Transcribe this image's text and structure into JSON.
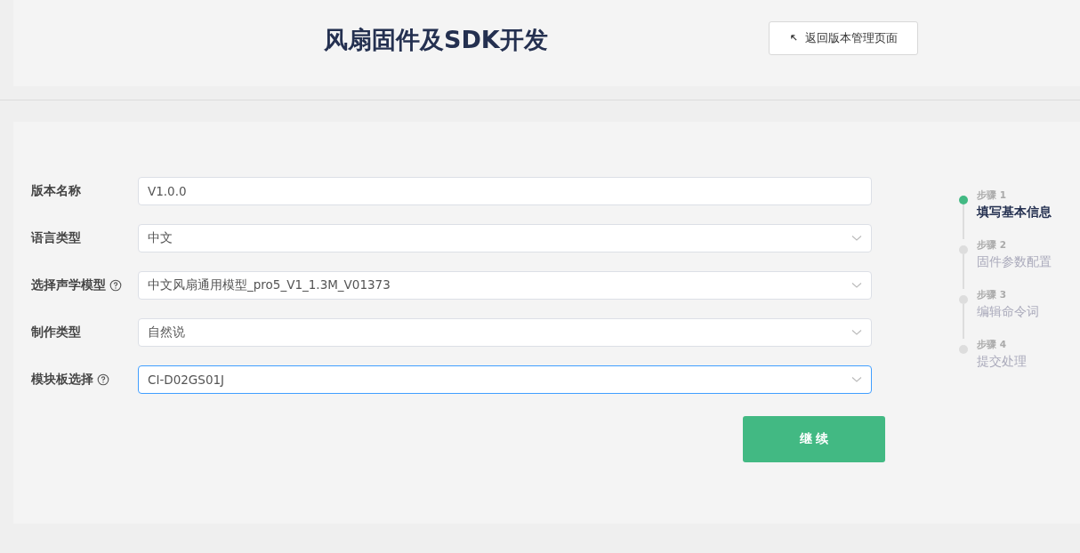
{
  "header": {
    "title": "风扇固件及SDK开发",
    "back_button": "返回版本管理页面"
  },
  "form": {
    "fields": [
      {
        "label": "版本名称",
        "kind": "text",
        "value": "V1.0.0",
        "help": false,
        "focused": false
      },
      {
        "label": "语言类型",
        "kind": "select",
        "value": "中文",
        "help": false,
        "focused": false
      },
      {
        "label": "选择声学模型",
        "kind": "select",
        "value": "中文风扇通用模型_pro5_V1_1.3M_V01373",
        "help": true,
        "focused": false
      },
      {
        "label": "制作类型",
        "kind": "select",
        "value": "自然说",
        "help": false,
        "focused": false
      },
      {
        "label": "模块板选择",
        "kind": "select",
        "value": "CI-D02GS01J",
        "help": true,
        "focused": true
      }
    ],
    "submit": "继 续"
  },
  "steps": [
    {
      "step": "步骤 1",
      "title": "填写基本信息",
      "selected": true
    },
    {
      "step": "步骤 2",
      "title": "固件参数配置",
      "selected": false
    },
    {
      "step": "步骤 3",
      "title": "编辑命令词",
      "selected": false
    },
    {
      "step": "步骤 4",
      "title": "提交处理",
      "selected": false
    }
  ]
}
